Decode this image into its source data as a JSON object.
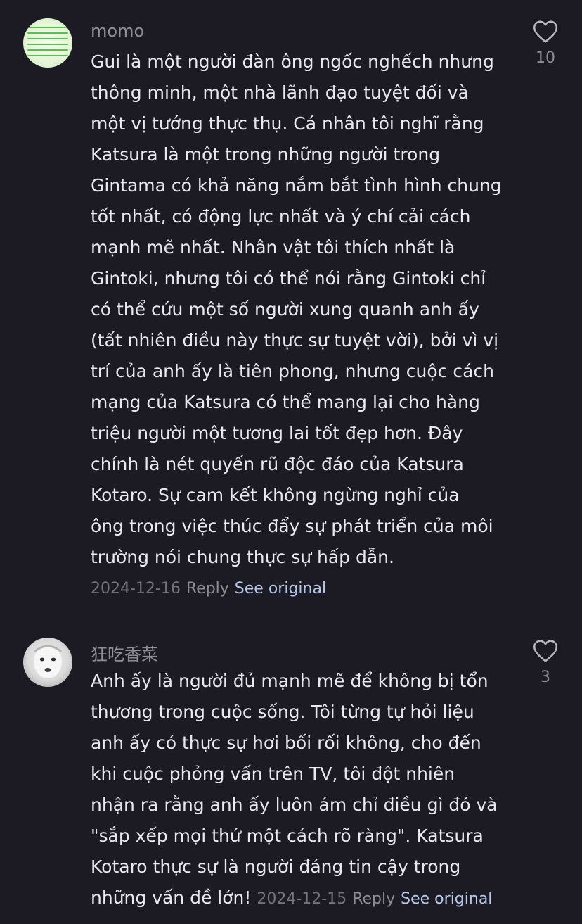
{
  "comments": [
    {
      "username": "momo",
      "avatar_icon": "green-text-avatar",
      "text_lines": [
        "Gui là một người đàn ông ngốc nghếch nhưng",
        "thông minh, một nhà lãnh đạo tuyệt đối và",
        "một vị tướng thực thụ. Cá nhân tôi nghĩ rằng",
        "Katsura là một trong những người trong",
        "Gintama có khả năng nắm bắt tình hình chung",
        "tốt nhất, có động lực nhất và ý chí cải cách",
        "mạnh mẽ nhất. Nhân vật tôi thích nhất là",
        "Gintoki, nhưng tôi có thể nói rằng Gintoki chỉ",
        "có thể cứu một số người xung quanh anh ấy",
        "(tất nhiên điều này thực sự tuyệt vời), bởi vì vị",
        "trí của anh ấy là tiên phong, nhưng cuộc cách",
        "mạng của Katsura có thể mang lại cho hàng",
        "triệu người một tương lai tốt đẹp hơn. Đây",
        "chính là nét quyến rũ độc đáo của Katsura",
        "Kotaro. Sự cam kết không ngừng nghỉ của",
        "ông trong việc thúc đẩy sự phát triển của môi",
        "trường nói chung thực sự hấp dẫn."
      ],
      "last_line_suffix": "",
      "date": "2024-12-16",
      "reply_label": "Reply",
      "see_original_label": "See original",
      "like_count": "10"
    },
    {
      "username": "狂吃香菜",
      "avatar_icon": "white-face-avatar",
      "text_lines": [
        "Anh ấy là người đủ mạnh mẽ để không bị tổn",
        "thương trong cuộc sống. Tôi từng tự hỏi liệu",
        "anh ấy có thực sự hơi bối rối không, cho đến",
        "khi cuộc phỏng vấn trên TV, tôi đột nhiên",
        "nhận ra rằng anh ấy luôn ám chỉ điều gì đó và",
        "\"sắp xếp mọi thứ một cách rõ ràng\". Katsura",
        "Kotaro thực sự là người đáng tin cậy trong",
        "những vấn đề lớn!"
      ],
      "date": "2024-12-15",
      "reply_label": "Reply",
      "see_original_label": "See original",
      "like_count": "3"
    }
  ],
  "colors": {
    "background": "#1c1b23",
    "text": "#e9e8ee",
    "muted": "#8d8c93",
    "link": "#b6c9ec"
  },
  "icons": {
    "like": "heart-outline-icon"
  }
}
